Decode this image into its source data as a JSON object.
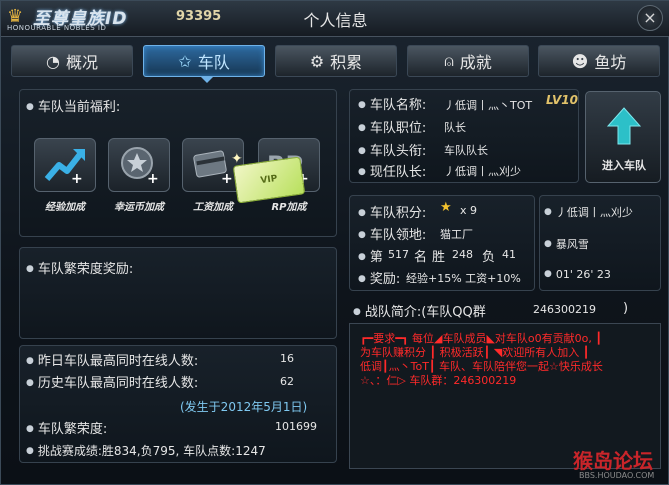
{
  "header": {
    "logo_text": "至尊皇族ID",
    "logo_sub": "HONOURABLE NOBLES ID",
    "user_id": "93395",
    "window_title": "个人信息",
    "close_label": "×"
  },
  "tabs": [
    {
      "label": "概况",
      "icon": "gauge-icon"
    },
    {
      "label": "车队",
      "icon": "star-icon",
      "active": true
    },
    {
      "label": "积累",
      "icon": "gear-icon"
    },
    {
      "label": "成就",
      "icon": "medal-icon"
    },
    {
      "label": "鱼坊",
      "icon": "fish-icon"
    }
  ],
  "welfare": {
    "title": "车队当前福利:",
    "items": [
      {
        "label": "经验加成",
        "icon": "exp-up-icon"
      },
      {
        "label": "幸运币加成",
        "icon": "lucky-coin-icon"
      },
      {
        "label": "工资加成",
        "icon": "salary-card-icon"
      },
      {
        "label": "RP加成",
        "icon": "rp-plus-icon"
      }
    ]
  },
  "prosperity_reward": {
    "title": "车队繁荣度奖励:"
  },
  "stats": {
    "yesterday_label": "昨日车队最高同时在线人数:",
    "yesterday_value": "16",
    "history_label": "历史车队最高同时在线人数:",
    "history_value": "62",
    "history_date": "(发生于2012年5月1日)",
    "prosperity_label": "车队繁荣度:",
    "prosperity_value": "101699",
    "challenge_text": "挑战赛成绩:胜834,负795, 车队点数:1247"
  },
  "team_info": {
    "name_label": "车队名称:",
    "name_value": "丿低调丨灬丶TOT",
    "level": "LV10",
    "position_label": "车队职位:",
    "position_value": "队长",
    "title_label": "车队头衔:",
    "title_value": "车队队长",
    "captain_label": "现任队长:",
    "captain_value": "丿低调丨灬刈少"
  },
  "enter_button": {
    "label": "进入车队"
  },
  "team_score": {
    "points_label": "车队积分:",
    "points_value": "x 9",
    "territory_label": "车队领地:",
    "territory_value": "猫工厂",
    "rank_prefix": "第",
    "rank_value": "517",
    "rank_suffix": "名",
    "win_label": "胜",
    "win_value": "248",
    "lose_label": "负",
    "lose_value": "41",
    "reward_label": "奖励:",
    "reward_value": "经验+15% 工资+10%"
  },
  "members": {
    "name1": "丿低调丨灬刈少",
    "name2": "暴风雪",
    "time": "01' 26' 23"
  },
  "intro": {
    "label": "战队简介:(车队QQ群",
    "qq": "246300219",
    "close_paren": ")",
    "text_line1": "┏━要求━┓ 每位◢车队成员◣对车队o0有贡献0o, ┃",
    "text_line2": "为车队赚积分 ┃ 积极活跃┃ ◥欢迎所有人加入 ┃",
    "text_line3": "低调┃灬丶ToT┃ 车队、车队陪伴您一起☆快乐成长",
    "text_line4": "☆、：仁▷      车队群：246300219"
  },
  "watermark": {
    "text": "猴岛论坛",
    "sub": "BBS.HOUDAO.COM"
  },
  "colors": {
    "accent": "#6fb2e8",
    "intro_text": "#ff2a2a",
    "level": "#e1c26a"
  }
}
